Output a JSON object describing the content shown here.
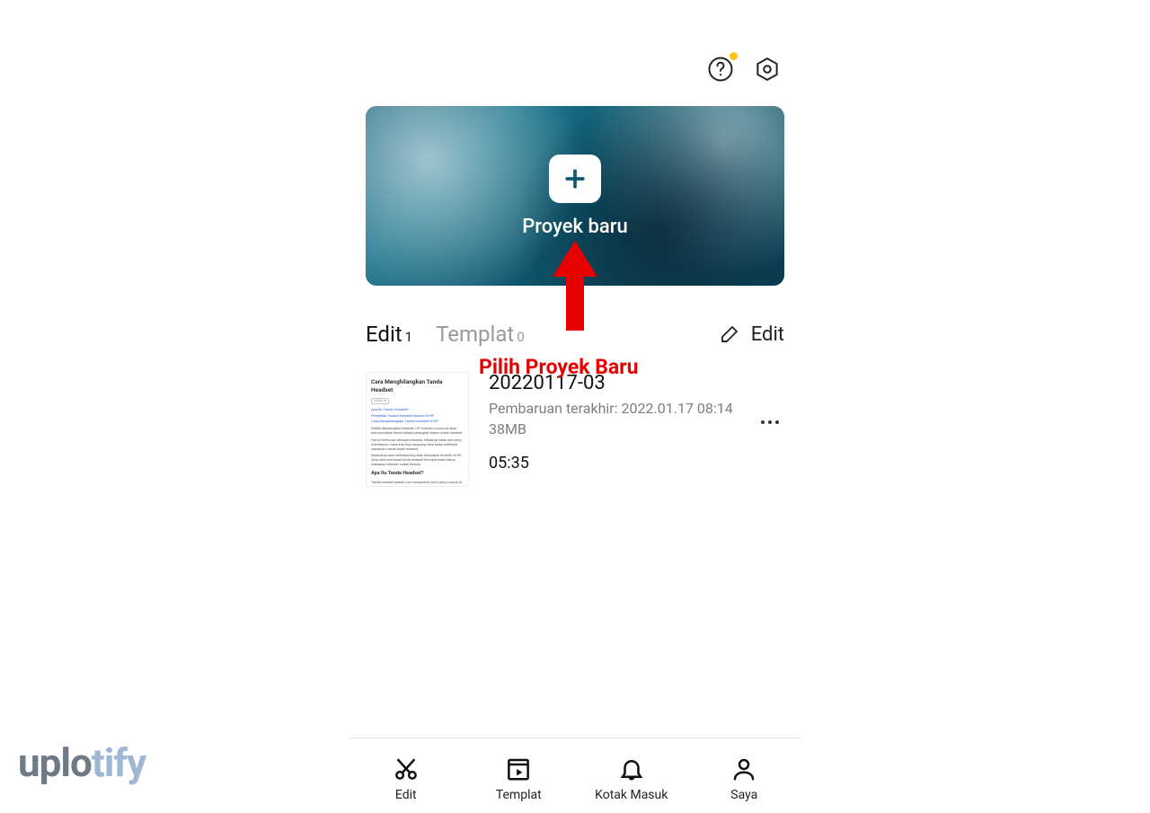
{
  "hero": {
    "label": "Proyek baru"
  },
  "tabs": {
    "edit": {
      "label": "Edit",
      "count": "1"
    },
    "template": {
      "label": "Templat",
      "count": "0"
    }
  },
  "editButton": {
    "label": "Edit"
  },
  "project": {
    "name": "20220117-03",
    "lastUpdate": "Pembaruan terakhir: 2022.01.17 08:14",
    "size": "38MB",
    "duration": "05:35",
    "thumbTitle": "Cara Menghilangkan Tanda Headset",
    "thumbSub": "Apa Itu Tanda Headset?"
  },
  "nav": {
    "edit": "Edit",
    "template": "Templat",
    "inbox": "Kotak Masuk",
    "me": "Saya"
  },
  "annotation": {
    "text": "Pilih Proyek Baru"
  },
  "watermark": {
    "a": "uplo",
    "b": "tify"
  }
}
